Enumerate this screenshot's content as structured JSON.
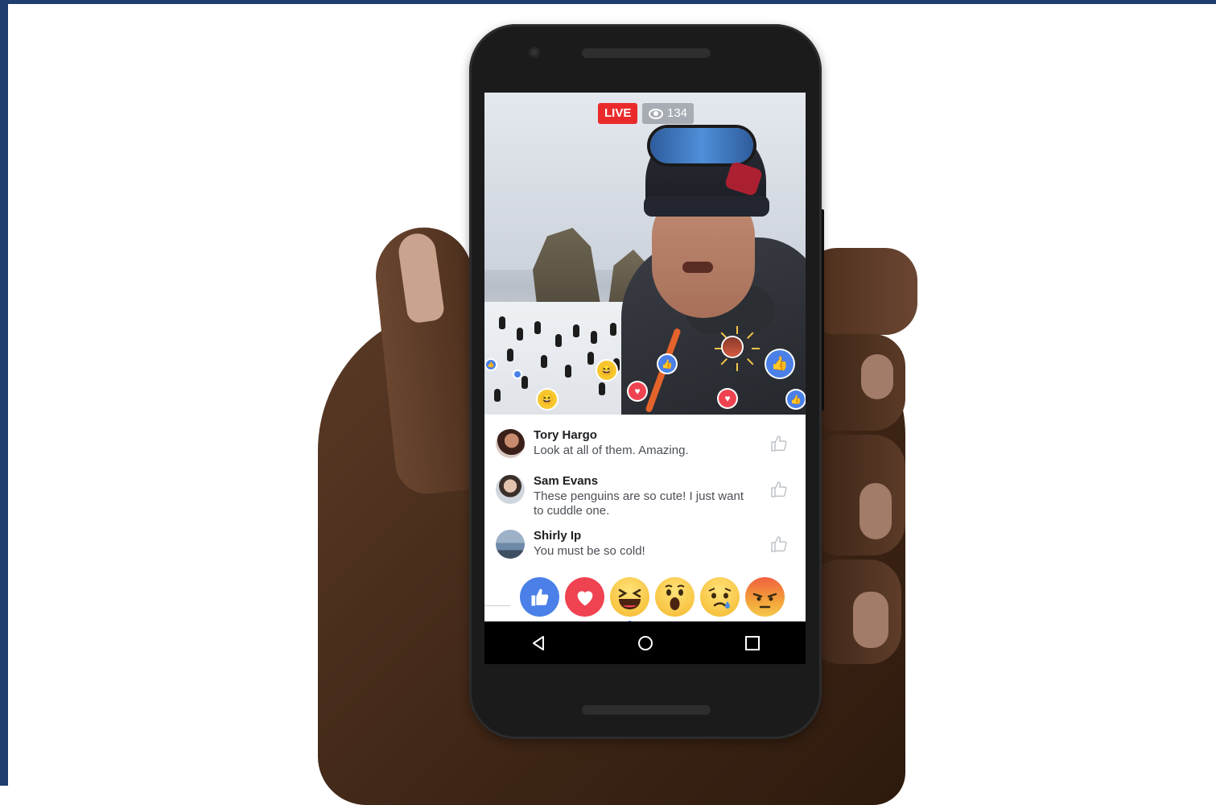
{
  "live": {
    "badge_label": "LIVE",
    "viewer_count": "134"
  },
  "comments": [
    {
      "name": "Tory Hargo",
      "text": "Look at all of them. Amazing."
    },
    {
      "name": "Sam Evans",
      "text": "These penguins are so cute! I just want to cuddle one."
    },
    {
      "name": "Shirly Ip",
      "text": "You must be so cold!"
    }
  ],
  "reactions": [
    "like",
    "love",
    "haha",
    "wow",
    "sad",
    "angry"
  ],
  "nav": [
    "back-icon",
    "home-icon",
    "recents-icon"
  ],
  "colors": {
    "live_red": "#ea2a2a",
    "like_blue": "#4a80e8",
    "love_red": "#ef4352",
    "frame_blue": "#1f3d6e"
  }
}
